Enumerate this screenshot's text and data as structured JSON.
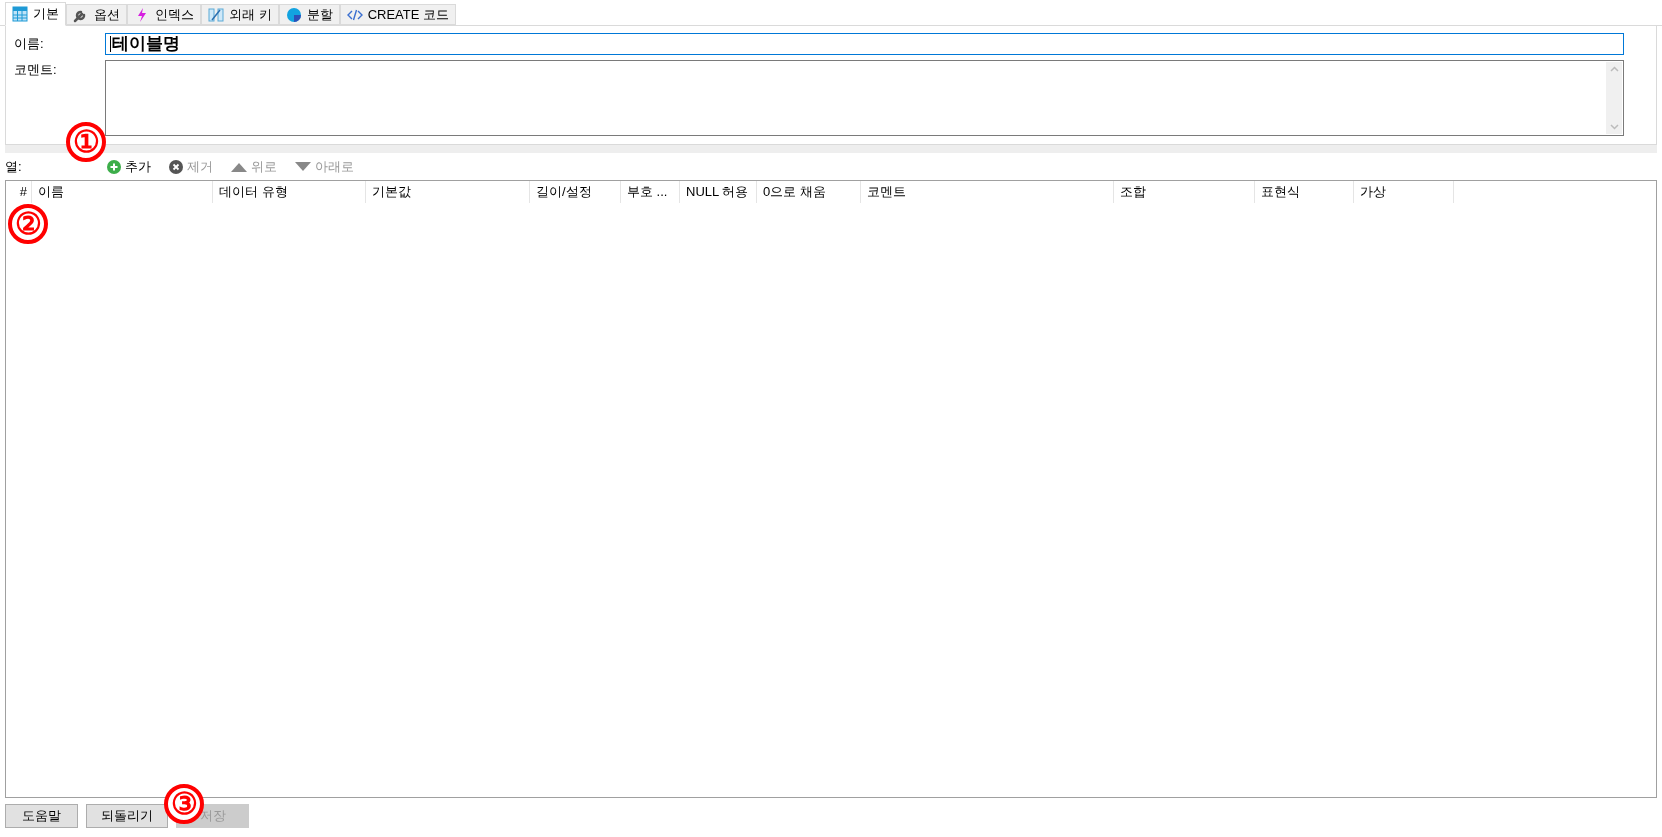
{
  "tabs": [
    {
      "label": "기본",
      "kind": "table",
      "selected": true
    },
    {
      "label": "옵션",
      "kind": "wrench",
      "selected": false
    },
    {
      "label": "인덱스",
      "kind": "bolt",
      "selected": false
    },
    {
      "label": "외래 키",
      "kind": "fk",
      "selected": false
    },
    {
      "label": "분할",
      "kind": "pie",
      "selected": false
    },
    {
      "label": "CREATE 코드",
      "kind": "code",
      "selected": false
    }
  ],
  "name_field": {
    "label": "이름:",
    "value": "테이블명"
  },
  "comment_field": {
    "label": "코멘트:"
  },
  "columns_toolbar": {
    "label": "열:",
    "actions": [
      {
        "label": "추가",
        "kind": "add",
        "disabled": false
      },
      {
        "label": "제거",
        "kind": "remove",
        "disabled": true
      },
      {
        "label": "위로",
        "kind": "up",
        "disabled": true
      },
      {
        "label": "아래로",
        "kind": "down",
        "disabled": true
      }
    ]
  },
  "table": {
    "columns": [
      "#",
      "이름",
      "데이터 유형",
      "기본값",
      "길이/설정",
      "부호 ...",
      "NULL 허용",
      "0으로 채움",
      "코멘트",
      "조합",
      "표현식",
      "가상"
    ]
  },
  "buttons": [
    {
      "label": "도움말",
      "disabled": false
    },
    {
      "label": "되돌리기",
      "disabled": false
    },
    {
      "label": "저장",
      "disabled": true
    }
  ],
  "annotations": [
    "①",
    "②",
    "③"
  ]
}
